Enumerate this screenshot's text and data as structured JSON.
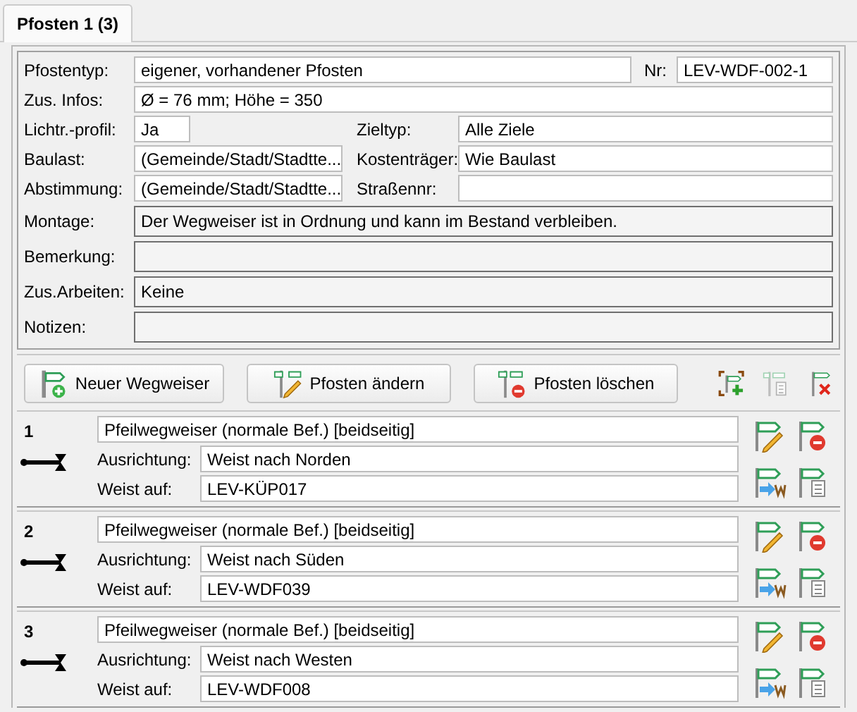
{
  "tab": {
    "label": "Pfosten 1 (3)",
    "selected": true
  },
  "post": {
    "type": {
      "label": "Pfostentyp:",
      "value": "eigener, vorhandener Pfosten"
    },
    "nr": {
      "label": "Nr:",
      "value": "LEV-WDF-002-1"
    },
    "info": {
      "label": "Zus. Infos:",
      "value": "Ø = 76 mm; Höhe = 350"
    },
    "profile": {
      "label": "Lichtr.-profil:",
      "value": "Ja"
    },
    "target_type": {
      "label": "Zieltyp:",
      "value": "Alle Ziele"
    },
    "baulast": {
      "label": "Baulast:",
      "value": "(Gemeinde/Stadt/Stadtte..."
    },
    "cost": {
      "label": "Kostenträger:",
      "value": "Wie Baulast"
    },
    "vote": {
      "label": "Abstimmung:",
      "value": "(Gemeinde/Stadt/Stadtte..."
    },
    "street": {
      "label": "Straßennr:"
    },
    "notes": [
      {
        "label": "Montage:",
        "value": "Der Wegweiser ist in Ordnung und kann im Bestand verbleiben."
      },
      {
        "label": "Bemerkung:"
      },
      {
        "label": "Zus.Arbeiten:",
        "value": "Keine"
      },
      {
        "label": "Notizen:"
      }
    ]
  },
  "buttons": [
    {
      "label": "Neuer Wegweiser",
      "kind": "new"
    },
    {
      "label": "Pfosten ändern",
      "kind": "edit"
    },
    {
      "label": "Pfosten löschen",
      "kind": "delete"
    }
  ],
  "signs": [
    {
      "number": "1",
      "type": "Pfeilwegweiser (normale Bef.) [beidseitig]",
      "direction_label": "Ausrichtung:",
      "direction": "Weist nach Norden",
      "target_label": "Weist auf:",
      "target": "LEV-KÜP017"
    },
    {
      "number": "2",
      "type": "Pfeilwegweiser (normale Bef.) [beidseitig]",
      "direction_label": "Ausrichtung:",
      "direction": "Weist nach Süden",
      "target_label": "Weist auf:",
      "target": "LEV-WDF039"
    },
    {
      "number": "3",
      "type": "Pfeilwegweiser (normale Bef.) [beidseitig]",
      "direction_label": "Ausrichtung:",
      "direction": "Weist nach Westen",
      "target_label": "Weist auf:",
      "target": "LEV-WDF008"
    }
  ]
}
